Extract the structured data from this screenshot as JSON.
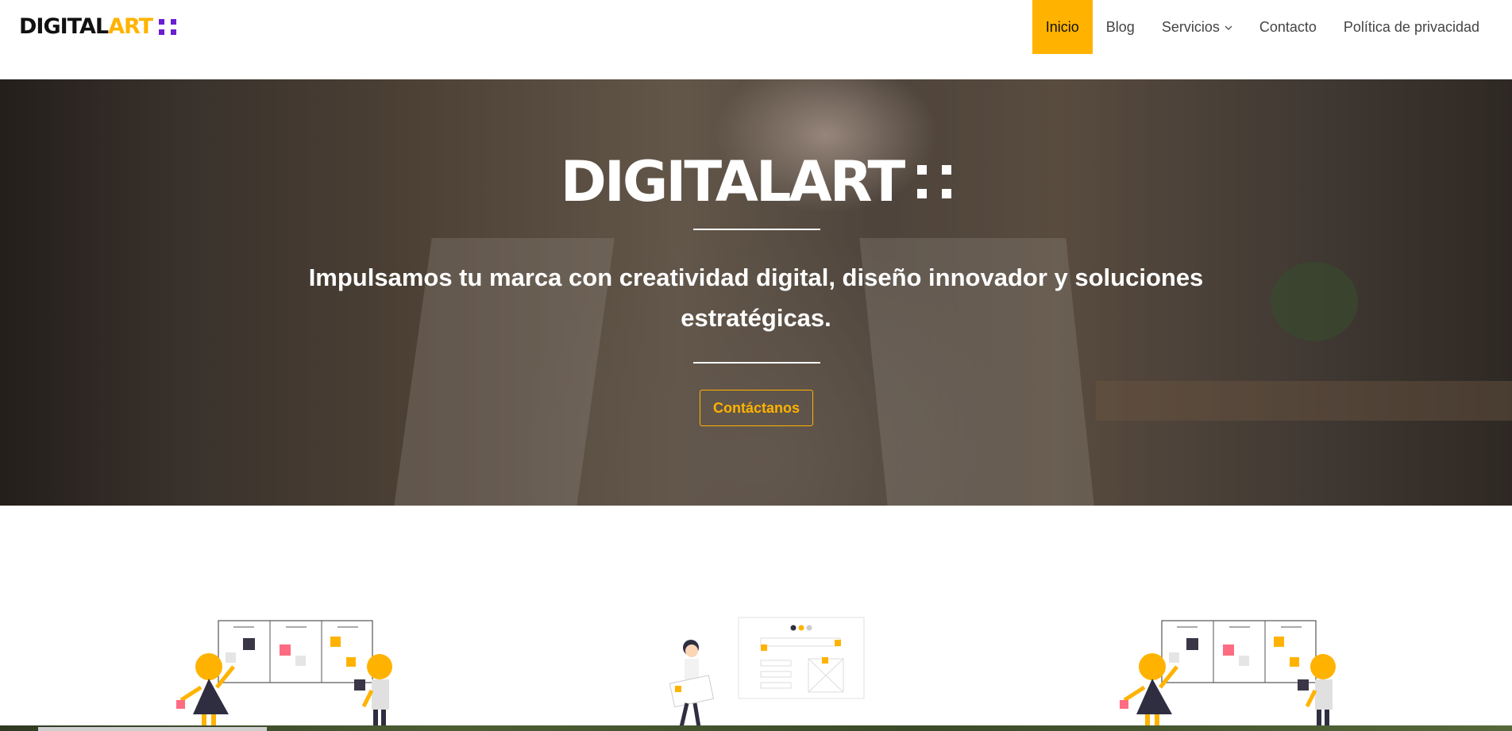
{
  "brand": {
    "logo_dark": "DIGITAL",
    "logo_accent": "ART"
  },
  "nav": {
    "items": [
      {
        "label": "Inicio",
        "active": true
      },
      {
        "label": "Blog"
      },
      {
        "label": "Servicios",
        "has_dropdown": true
      },
      {
        "label": "Contacto"
      },
      {
        "label": "Política de privacidad"
      }
    ]
  },
  "hero": {
    "title": "DIGITALART",
    "text": "Impulsamos tu marca con creatividad digital, diseño innovador y soluciones estratégicas.",
    "cta_label": "Contáctanos"
  },
  "colors": {
    "accent": "#FFB300",
    "logo_dots": "#6a1fd1",
    "text_dark": "#111111"
  },
  "icons": {
    "dropdown": "chevron-down-icon"
  }
}
